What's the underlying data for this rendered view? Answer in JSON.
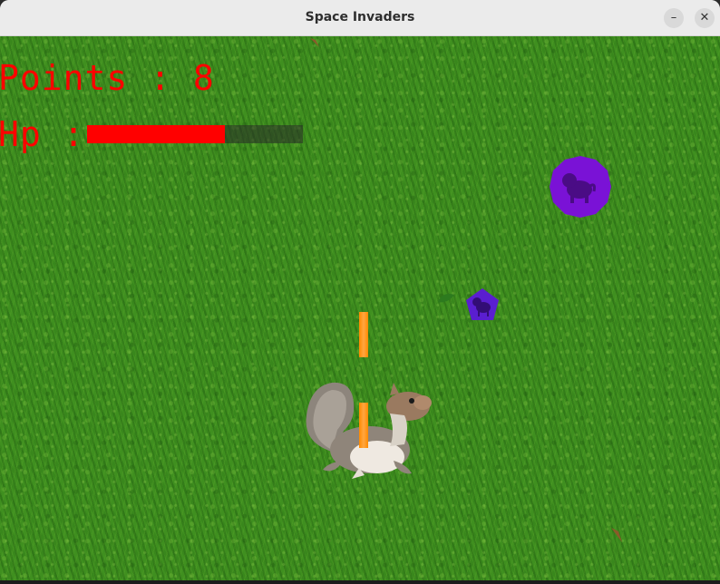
{
  "window": {
    "title": "Space Invaders",
    "minimize_icon": "–",
    "close_icon": "✕"
  },
  "hud": {
    "points_label": "Points : 8",
    "hp_label": "Hp :",
    "hp_fraction": 0.64,
    "text_color": "#ff0000",
    "hp_fill_color": "#ff0000"
  },
  "game": {
    "background": "grass",
    "enemies": [
      {
        "shape": "circle",
        "color": "#7a12d6",
        "icon": "pug-icon"
      },
      {
        "shape": "pentagon",
        "color": "#5a1ed0",
        "icon": "pug-icon"
      }
    ],
    "player_sprite": "squirrel",
    "projectile_color": "#ff8a00"
  }
}
